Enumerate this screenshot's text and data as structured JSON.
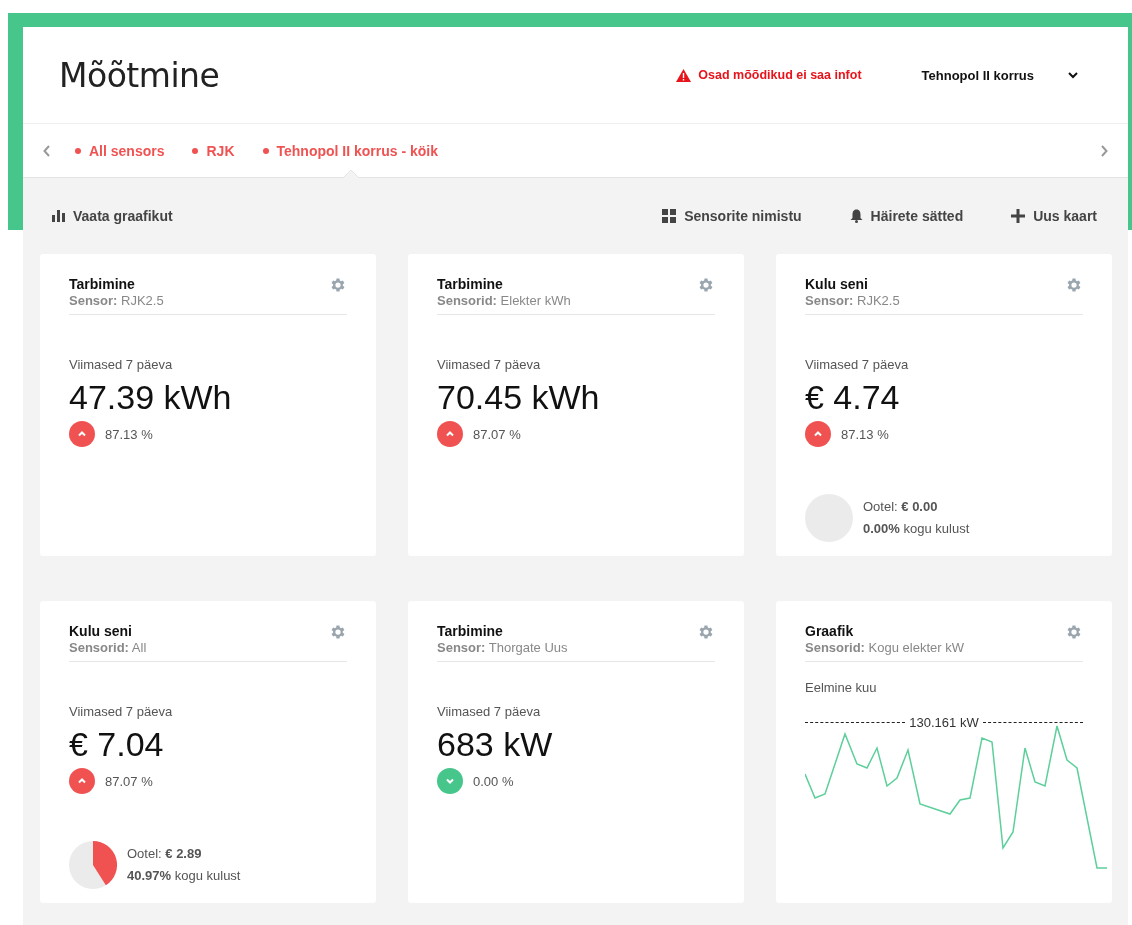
{
  "header": {
    "title": "Mõõtmine",
    "warning": "Osad mõõdikud ei saa infot",
    "location": "Tehnopol II korrus"
  },
  "tabs": [
    {
      "label": "All sensors",
      "selected": false
    },
    {
      "label": "RJK",
      "selected": false
    },
    {
      "label": "Tehnopol II korrus - köik",
      "selected": true
    }
  ],
  "toolbar": {
    "left": "Vaata graafikut",
    "right": [
      {
        "kind": "grid",
        "label": "Sensorite nimistu"
      },
      {
        "kind": "bell",
        "label": "Häirete sätted"
      },
      {
        "kind": "plus",
        "label": "Uus kaart"
      }
    ]
  },
  "cards": [
    {
      "kind": "stat",
      "title": "Tarbimine",
      "subtitle": "**Sensor:** RJK2.5",
      "period": "Viimased 7 päeva",
      "value": "47.39 kWh",
      "trend": {
        "kind": "up",
        "text": "87.13 %"
      }
    },
    {
      "kind": "stat",
      "title": "Tarbimine",
      "subtitle": "**Sensorid:** Elekter kWh",
      "period": "Viimased 7 päeva",
      "value": "70.45 kWh",
      "trend": {
        "kind": "up",
        "text": "87.07 %"
      }
    },
    {
      "kind": "stat",
      "title": "Kulu seni",
      "subtitle": "**Sensor:** RJK2.5",
      "period": "Viimased 7 päeva",
      "value": "€ 4.74",
      "trend": {
        "kind": "up",
        "text": "87.13 %"
      },
      "pending": {
        "kind": "empty",
        "amount": "Ootel: **€ 0.00**",
        "share": "**0.00%** kogu kulust"
      }
    },
    {
      "kind": "stat",
      "title": "Kulu seni",
      "subtitle": "**Sensorid:** All",
      "period": "Viimased 7 päeva",
      "value": "€ 7.04",
      "trend": {
        "kind": "up",
        "text": "87.07 %"
      },
      "pending": {
        "kind": "partial",
        "amount": "Ootel: **€ 2.89**",
        "share": "**40.97%** kogu kulust"
      }
    },
    {
      "kind": "stat",
      "title": "Tarbimine",
      "subtitle": "**Sensor:** Thorgate Uus",
      "period": "Viimased 7 päeva",
      "value": "683 kW",
      "trend": {
        "kind": "down",
        "text": "0.00 %"
      }
    },
    {
      "kind": "chart",
      "title": "Graafik",
      "subtitle": "**Sensorid:** Kogu elekter kW",
      "period": "Eelmine kuu",
      "max_label": "130.161 kW"
    }
  ]
}
